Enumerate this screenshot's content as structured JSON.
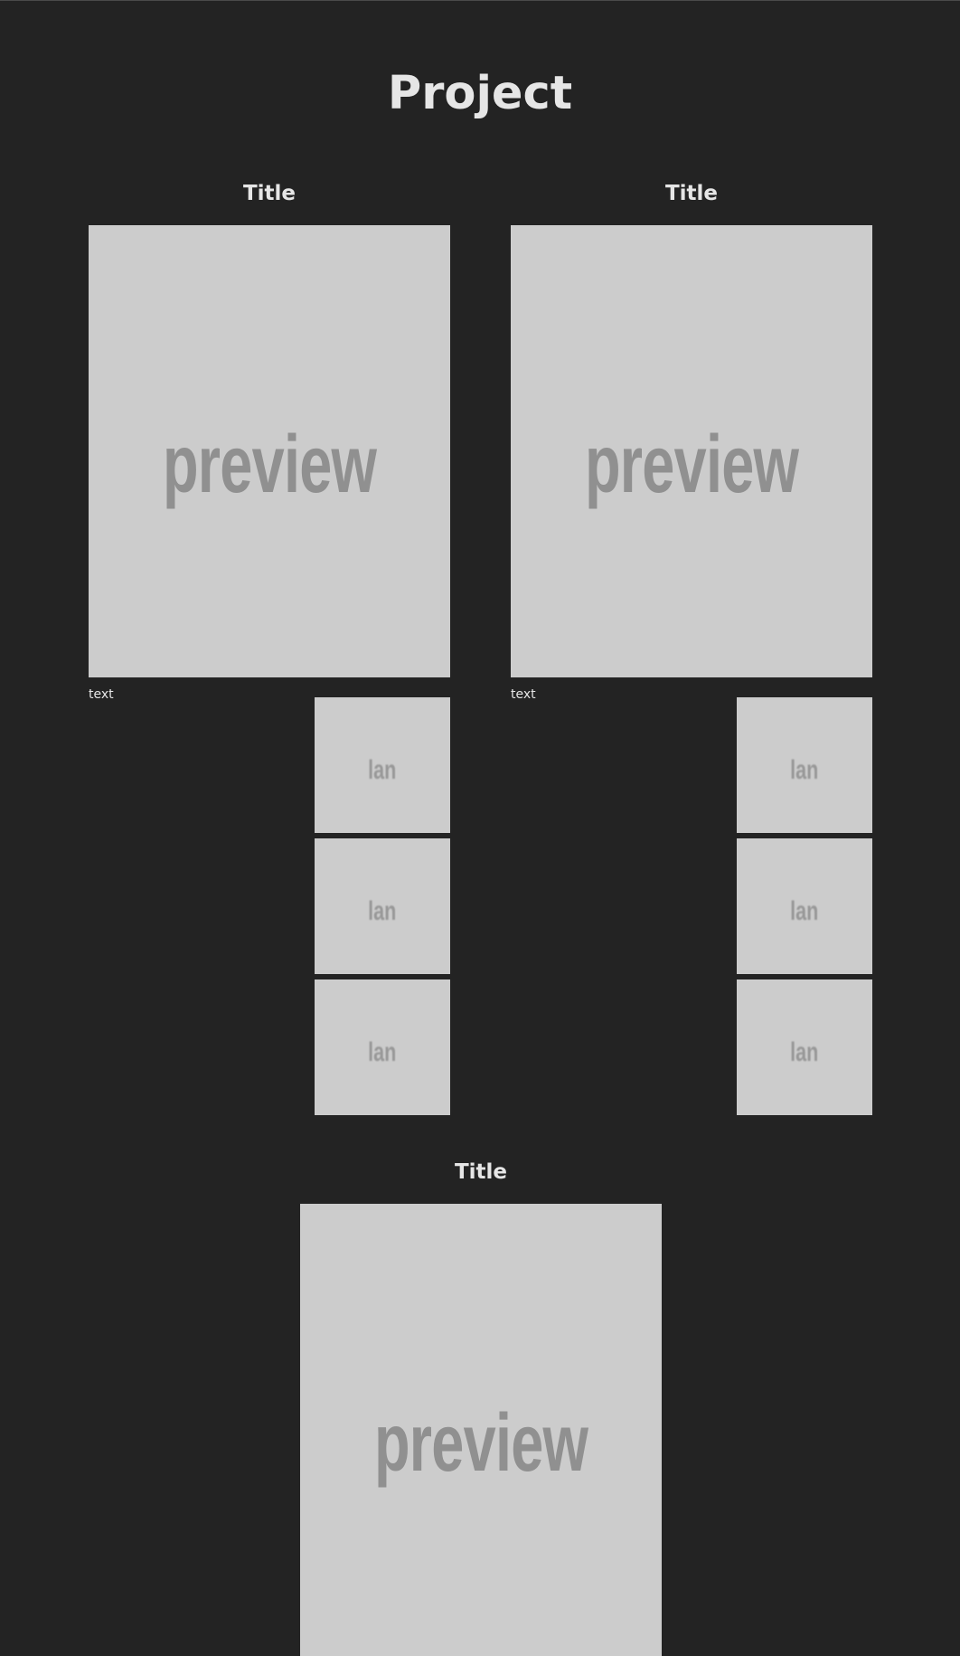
{
  "page": {
    "title": "Project"
  },
  "projects": [
    {
      "title": "Title",
      "preview_label": "preview",
      "caption": "text",
      "thumbs": [
        "lan",
        "lan",
        "lan"
      ]
    },
    {
      "title": "Title",
      "preview_label": "preview",
      "caption": "text",
      "thumbs": [
        "lan",
        "lan",
        "lan"
      ]
    },
    {
      "title": "Title",
      "preview_label": "preview"
    }
  ],
  "colors": {
    "background": "#232323",
    "text": "#e6e6e6",
    "placeholder_fill": "#cccccc",
    "placeholder_text": "#909090"
  }
}
